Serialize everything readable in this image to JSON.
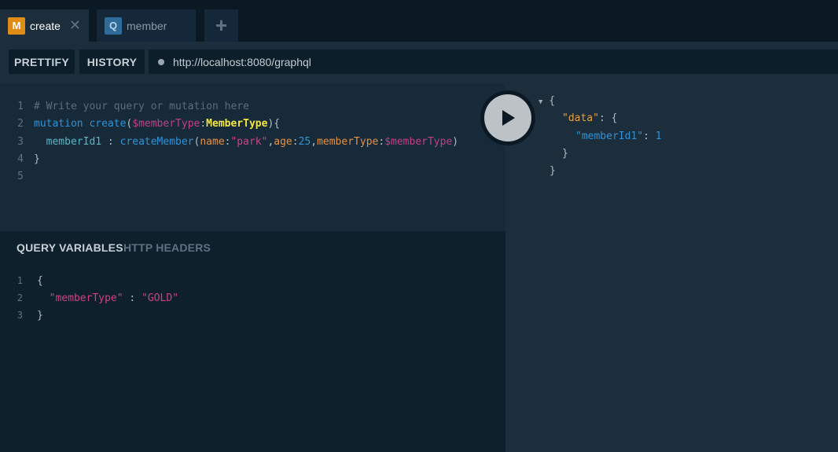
{
  "tabs": [
    {
      "badge": "M",
      "label": "create",
      "active": true,
      "close": "✕"
    },
    {
      "badge": "Q",
      "label": "member",
      "active": false
    }
  ],
  "tab_add_icon": "+",
  "toolbar": {
    "prettify_label": "PRETTIFY",
    "history_label": "HISTORY",
    "url": "http://localhost:8080/graphql"
  },
  "editor": {
    "lines": [
      {
        "num": "1",
        "comment": "# Write your query or mutation here"
      },
      {
        "num": "2",
        "keyword": "mutation",
        "name": "create",
        "var": "$memberType",
        "type": "MemberType"
      },
      {
        "num": "3",
        "alias": "memberId1",
        "field": "createMember",
        "arg_name": "name",
        "arg_name_value": "\"park\"",
        "arg_age": "age",
        "arg_age_value": "25",
        "arg_type": "memberType",
        "arg_type_value": "$memberType"
      },
      {
        "num": "4",
        "text": "}"
      },
      {
        "num": "5",
        "text": ""
      }
    ]
  },
  "variables": {
    "tab_query_variables": "QUERY VARIABLES",
    "tab_http_headers": "HTTP HEADERS",
    "lines": [
      {
        "num": "1",
        "text": "{"
      },
      {
        "num": "2",
        "key": "\"memberType\"",
        "value": "\"GOLD\""
      },
      {
        "num": "3",
        "text": "}"
      }
    ]
  },
  "result": {
    "data_key": "\"data\"",
    "member_key": "\"memberId1\"",
    "member_value": "1"
  },
  "colors": {
    "accent_mutation_badge": "#e08d17",
    "accent_query_badge": "#2f6b9a",
    "string": "#d04085",
    "keyword": "#2e93d8",
    "type": "#f4e542"
  }
}
